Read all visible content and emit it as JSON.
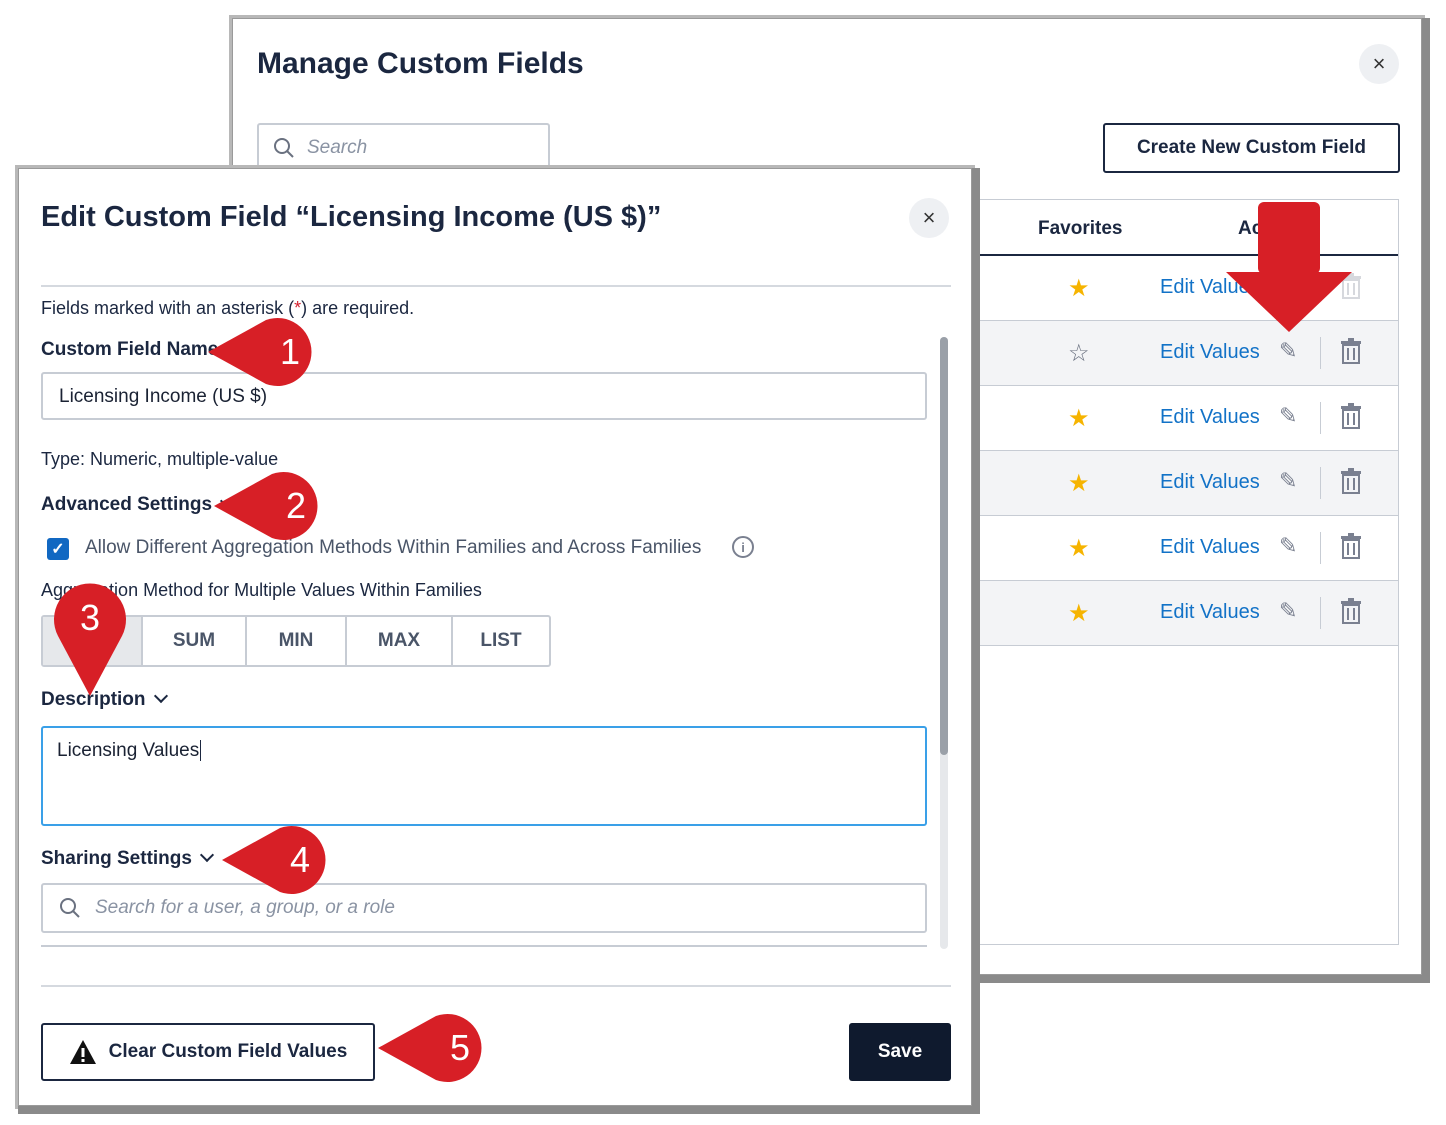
{
  "manage": {
    "title": "Manage Custom Fields",
    "close": "×",
    "search_placeholder": "Search",
    "create_button": "Create New Custom Field",
    "table": {
      "headers": {
        "favorites": "Favorites",
        "actions": "Ac"
      },
      "rows": [
        {
          "favorite": true,
          "edit_label": "Edit Value"
        },
        {
          "favorite": false,
          "edit_label": "Edit Values"
        },
        {
          "favorite": true,
          "edit_label": "Edit Values"
        },
        {
          "favorite": true,
          "edit_label": "Edit Values"
        },
        {
          "favorite": true,
          "edit_label": "Edit Values"
        },
        {
          "favorite": true,
          "edit_label": "Edit Values"
        }
      ]
    }
  },
  "edit": {
    "title": "Edit Custom Field “Licensing Income (US $)”",
    "close": "×",
    "required_note_pre": "Fields marked with an asterisk (",
    "required_star": "*",
    "required_note_post": ") are required.",
    "name_label": "Custom Field Name",
    "name_value": "Licensing Income (US $)",
    "type_text": "Type: Numeric, multiple-value",
    "advanced_label": "Advanced Settings",
    "checkbox_label": "Allow Different Aggregation Methods Within Families and Across Families",
    "checkbox_checked": true,
    "info_icon": "i",
    "aggregation_label": "Aggregation Method for Multiple Values Within Families",
    "aggregation_options": [
      "",
      "SUM",
      "MIN",
      "MAX",
      "LIST"
    ],
    "description_label": "Description",
    "description_value": "Licensing Values",
    "sharing_label": "Sharing Settings",
    "sharing_placeholder": "Search for a user, a group, or a role",
    "clear_button": "Clear Custom Field Values",
    "save_button": "Save"
  },
  "callouts": [
    "1",
    "2",
    "3",
    "4",
    "5"
  ],
  "colors": {
    "callout": "#d71f26",
    "link": "#1272c7",
    "star": "#f6b400",
    "checkbox": "#1168c2",
    "primary": "#0f1a2e"
  }
}
